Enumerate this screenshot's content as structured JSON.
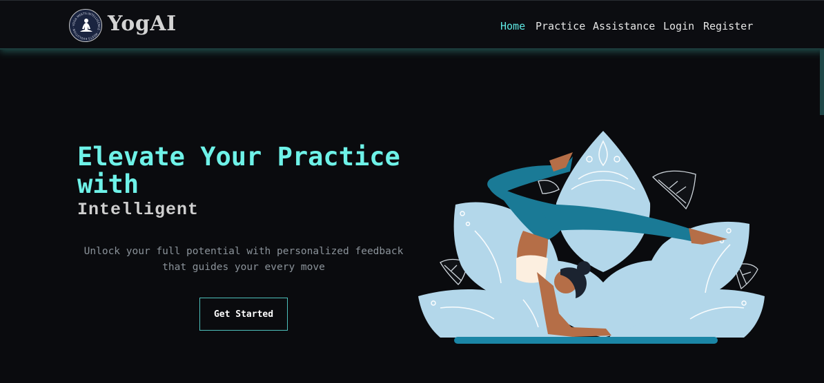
{
  "brand": {
    "name": "YogAI",
    "logo_ring_text": "YOGA MEETS INTELLIGENCE · MEETS EVOLUTION ·"
  },
  "nav": {
    "items": [
      {
        "label": "Home",
        "active": true
      },
      {
        "label": "Practice",
        "active": false
      },
      {
        "label": "Assistance",
        "active": false
      },
      {
        "label": "Login",
        "active": false
      },
      {
        "label": "Register",
        "active": false
      }
    ]
  },
  "hero": {
    "title": "Elevate Your Practice with",
    "subtitle": "Intelligent",
    "description": "Unlock your full potential with personalized feedback that guides your every move",
    "cta_label": "Get Started"
  },
  "colors": {
    "background": "#0a0b0e",
    "accent": "#5ee8e3",
    "title": "#6ef2e8",
    "lotus": "#b3d7ea",
    "pose_outfit": "#1a7a96"
  },
  "icons": {
    "logo": "meditating-figure-icon"
  }
}
